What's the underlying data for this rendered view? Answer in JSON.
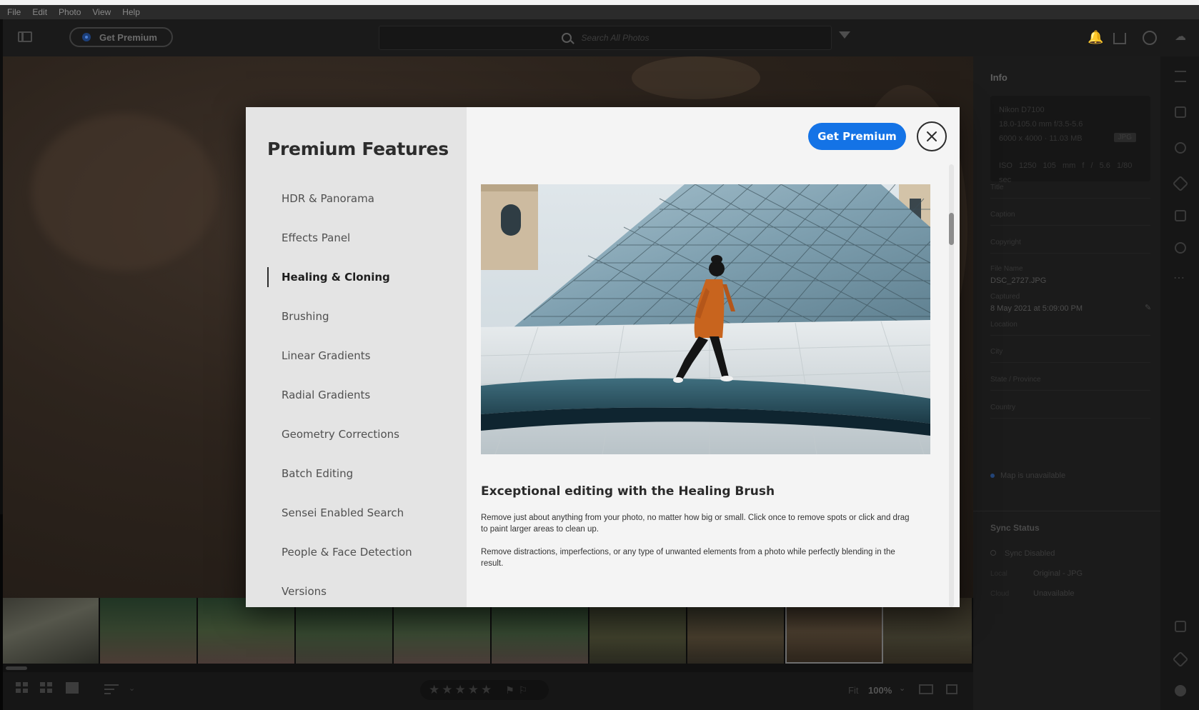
{
  "menu": [
    "File",
    "Edit",
    "Photo",
    "View",
    "Help"
  ],
  "toolbar": {
    "get_premium": "Get Premium",
    "search_placeholder": "Search All Photos"
  },
  "modal": {
    "title": "Premium Features",
    "get_premium": "Get Premium",
    "nav_items": [
      {
        "label": "HDR & Panorama",
        "active": false
      },
      {
        "label": "Effects Panel",
        "active": false
      },
      {
        "label": "Healing & Cloning",
        "active": true
      },
      {
        "label": "Brushing",
        "active": false
      },
      {
        "label": "Linear Gradients",
        "active": false
      },
      {
        "label": "Radial Gradients",
        "active": false
      },
      {
        "label": "Geometry Corrections",
        "active": false
      },
      {
        "label": "Batch Editing",
        "active": false
      },
      {
        "label": "Sensei Enabled Search",
        "active": false
      },
      {
        "label": "People & Face Detection",
        "active": false
      },
      {
        "label": "Versions",
        "active": false
      }
    ],
    "feature": {
      "heading": "Exceptional editing with the Healing Brush",
      "paragraph1": "Remove just about anything from your photo, no matter how big or small. Click once to remove spots or click and drag to paint larger areas to clean up.",
      "paragraph2": "Remove distractions, imperfections, or any type of unwanted elements from a photo while perfectly blending in the result."
    }
  },
  "info_panel": {
    "title": "Info",
    "camera": "Nikon D7100",
    "lens": "18.0-105.0 mm f/3.5-5.6",
    "dimensions": "6000 x 4000",
    "filesize": "11.03 MB",
    "format_badge": "JPG",
    "exif": {
      "iso": "ISO 1250",
      "focal": "105 mm",
      "aperture": "f / 5.6",
      "shutter": "1/80 sec"
    },
    "fields": {
      "title": "Title",
      "caption": "Caption",
      "copyright": "Copyright",
      "file_name_label": "File Name",
      "file_name": "DSC_2727.JPG",
      "captured_label": "Captured",
      "captured": "8 May 2021 at 5:09:00 PM",
      "location": "Location",
      "city": "City",
      "state": "State / Province",
      "country": "Country"
    },
    "map_note": "Map is unavailable",
    "sync": {
      "title": "Sync Status",
      "status": "Sync Disabled",
      "local_label": "Local",
      "local_value": "Original - JPG",
      "cloud_label": "Cloud",
      "cloud_value": "Unavailable"
    }
  },
  "bottombar": {
    "zoom_fit": "Fit",
    "zoom_value": "100%",
    "stars": "★★★★★",
    "flags": "⚑⚐"
  },
  "colors": {
    "accent": "#1473e6",
    "modal_bg": "#f4f4f4",
    "nav_bg": "#e4e4e4"
  }
}
